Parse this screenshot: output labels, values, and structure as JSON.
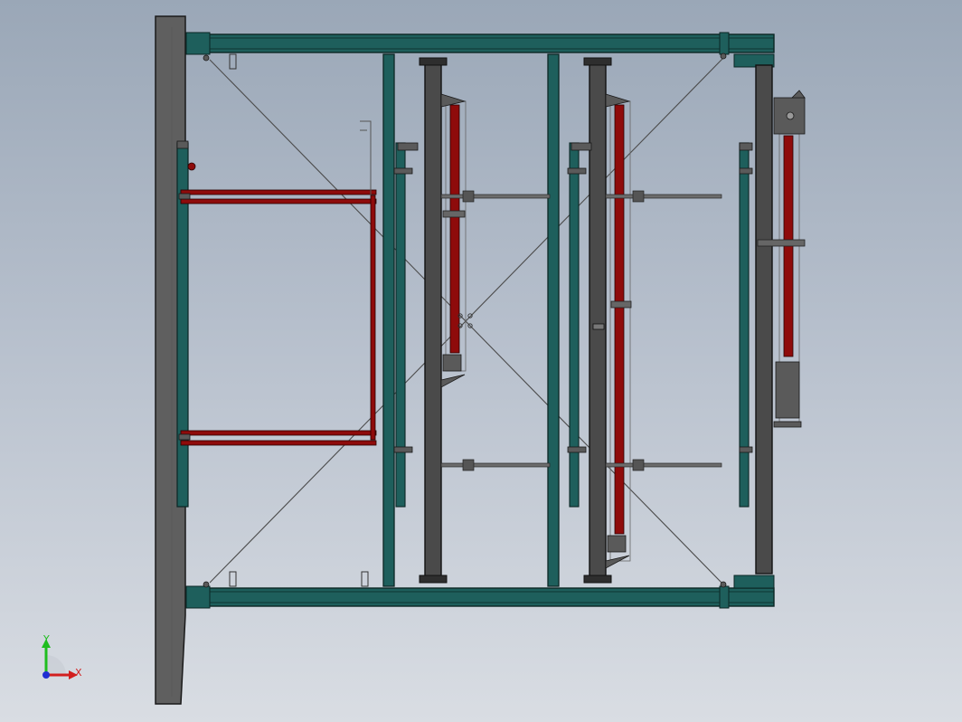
{
  "viewport": {
    "background_top": "#9aa7b7",
    "background_bottom": "#d9dde3"
  },
  "colors": {
    "frame_teal": "#1e5f5c",
    "frame_edge": "#0b2624",
    "column_gray": "#4a4a4a",
    "base_plate": "#5f5f5f",
    "cylinder_red": "#8e0b0b",
    "rod_gray": "#6c6c6c",
    "diagonal_line": "#4c4c4c",
    "axis_x": "#d21f1f",
    "axis_y": "#1fbd1f",
    "axis_z": "#1f2fd2"
  },
  "triad": {
    "x_label": "X",
    "y_label": "Y"
  }
}
